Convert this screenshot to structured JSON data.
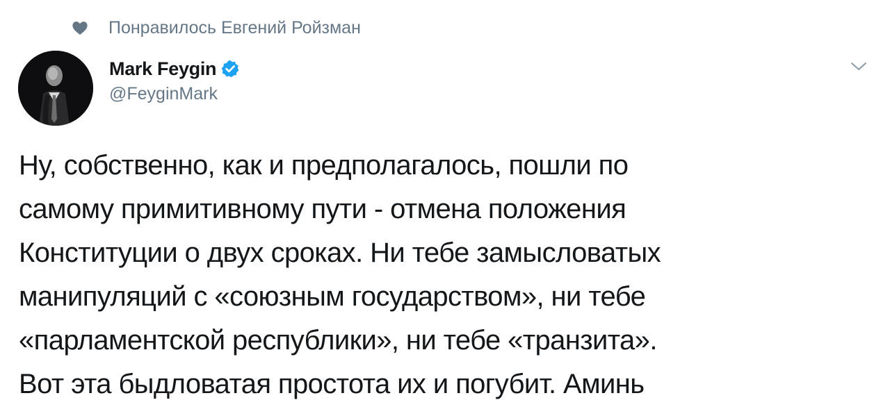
{
  "social_context": {
    "icon": "heart-icon",
    "text": "Понравилось Евгений Ройзман"
  },
  "author": {
    "display_name": "Mark Feygin",
    "handle": "@FeyginMark",
    "verified": true,
    "verified_color": "#1da1f2"
  },
  "tweet": {
    "lines": [
      "Ну, собственно, как и предполагалось, пошли по",
      "самому примитивному пути - отмена положения",
      "Конституции о двух сроках. Ни тебе замысловатых",
      "манипуляций с «союзным государством», ни тебе",
      "«парламентской республики», ни тебе «транзита».",
      "Вот эта быдловатая простота их и погубит. Аминь"
    ]
  },
  "colors": {
    "text": "#14171a",
    "secondary": "#657786",
    "accent": "#1da1f2"
  }
}
